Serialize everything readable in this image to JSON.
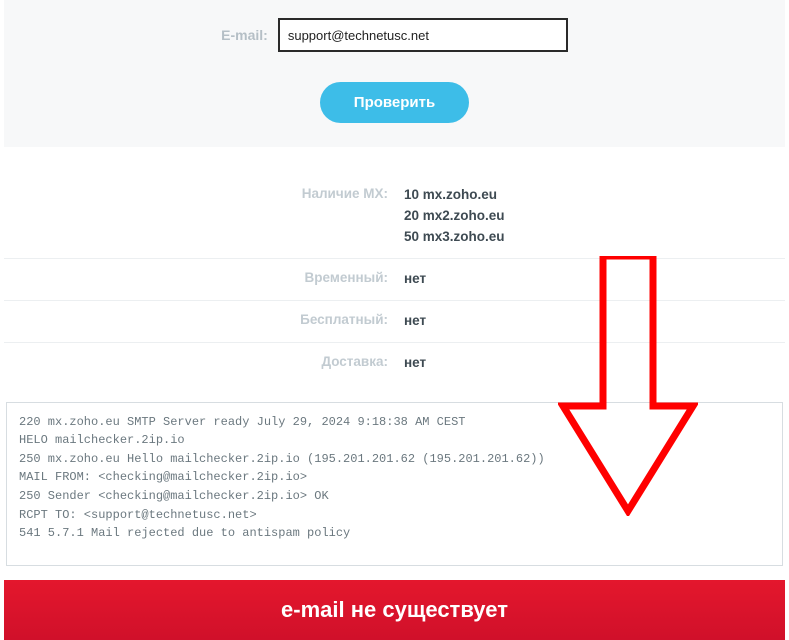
{
  "form": {
    "email_label": "E-mail:",
    "email_value": "support@technetusc.net",
    "check_label": "Проверить"
  },
  "results": {
    "mx_label": "Наличие MX:",
    "mx_records": [
      {
        "priority": "10",
        "host": "mx.zoho.eu"
      },
      {
        "priority": "20",
        "host": "mx2.zoho.eu"
      },
      {
        "priority": "50",
        "host": "mx3.zoho.eu"
      }
    ],
    "temporary_label": "Временный:",
    "temporary_value": "нет",
    "free_label": "Бесплатный:",
    "free_value": "нет",
    "delivery_label": "Доставка:",
    "delivery_value": "нет"
  },
  "log_lines": [
    "220 mx.zoho.eu SMTP Server ready July 29, 2024 9:18:38 AM CEST",
    "HELO mailchecker.2ip.io",
    "250 mx.zoho.eu Hello mailchecker.2ip.io (195.201.201.62 (195.201.201.62))",
    "MAIL FROM: <checking@mailchecker.2ip.io>",
    "250 Sender <checking@mailchecker.2ip.io> OK",
    "RCPT TO: <support@technetusc.net>",
    "541 5.7.1 Mail rejected due to antispam policy"
  ],
  "banner": {
    "text": "e-mail не существует",
    "color": "#e4172d"
  },
  "annotation": {
    "arrow_color": "#ff0000"
  }
}
